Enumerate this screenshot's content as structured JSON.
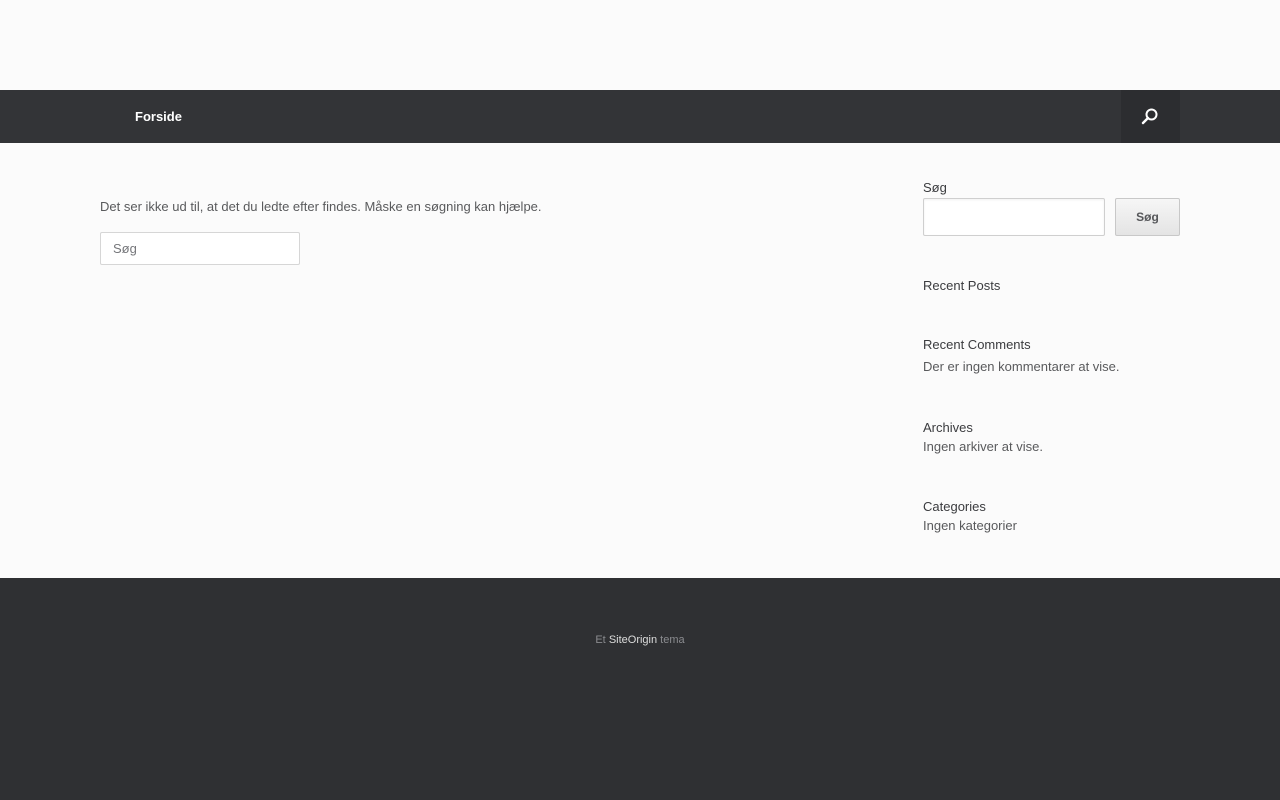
{
  "nav": {
    "items": [
      {
        "label": "Forside"
      }
    ],
    "search_icon": "search-icon"
  },
  "main": {
    "not_found_message": "Det ser ikke ud til, at det du ledte efter findes. Måske en søgning kan hjælpe.",
    "search_placeholder": "Søg"
  },
  "sidebar": {
    "search": {
      "title": "Søg",
      "button_label": "Søg",
      "value": ""
    },
    "recent_posts": {
      "title": "Recent Posts"
    },
    "recent_comments": {
      "title": "Recent Comments",
      "text": "Der er ingen kommentarer at vise."
    },
    "archives": {
      "title": "Archives",
      "text": "Ingen arkiver at vise."
    },
    "categories": {
      "title": "Categories",
      "text": "Ingen kategorier"
    }
  },
  "footer": {
    "prefix": "Et",
    "link_label": "SiteOrigin",
    "suffix": "tema"
  },
  "colors": {
    "background": "#fbfbfb",
    "navbar": "#333437",
    "footer": "#2f3033"
  }
}
